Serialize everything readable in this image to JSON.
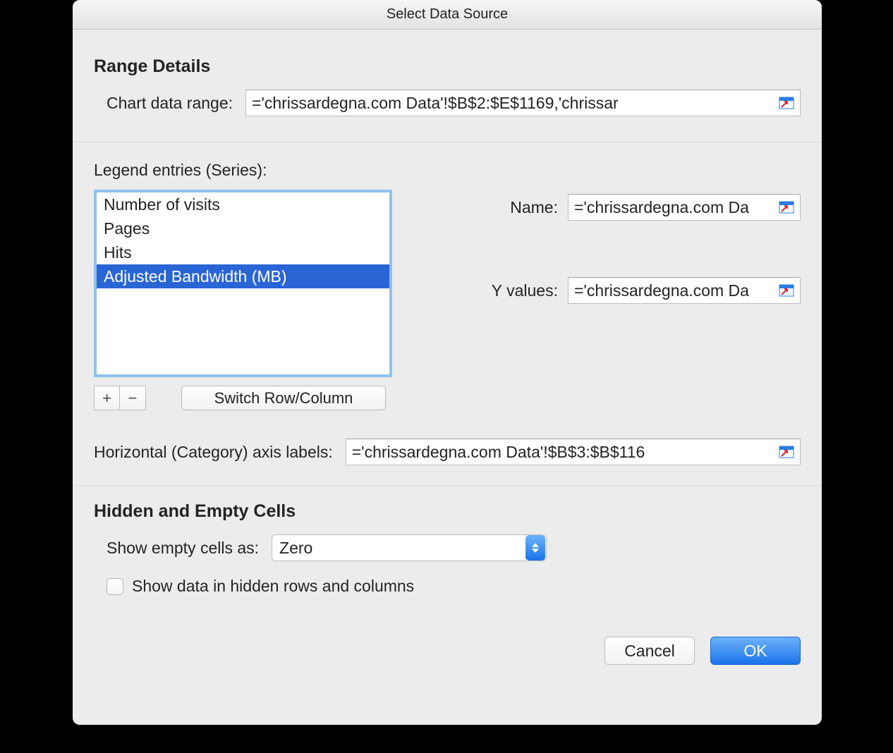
{
  "title": "Select Data Source",
  "sections": {
    "range": {
      "title": "Range Details",
      "chartDataRangeLabel": "Chart data range:",
      "chartDataRangeValue": "='chrissardegna.com Data'!$B$2:$E$1169,'chrissar"
    },
    "legend": {
      "title": "Legend entries (Series):",
      "items": [
        "Number of visits",
        "Pages",
        "Hits",
        "Adjusted Bandwidth (MB)"
      ],
      "selectedIndex": 3,
      "nameLabel": "Name:",
      "nameValue": "='chrissardegna.com Da",
      "yLabel": "Y values:",
      "yValue": "='chrissardegna.com Da",
      "switchButton": "Switch Row/Column",
      "axisLabel": "Horizontal (Category) axis labels:",
      "axisValue": "='chrissardegna.com Data'!$B$3:$B$116"
    },
    "hidden": {
      "title": "Hidden and Empty Cells",
      "emptyCellsLabel": "Show empty cells as:",
      "emptyCellsValue": "Zero",
      "showHiddenLabel": "Show data in hidden rows and columns",
      "showHiddenChecked": false
    }
  },
  "buttons": {
    "cancel": "Cancel",
    "ok": "OK"
  }
}
